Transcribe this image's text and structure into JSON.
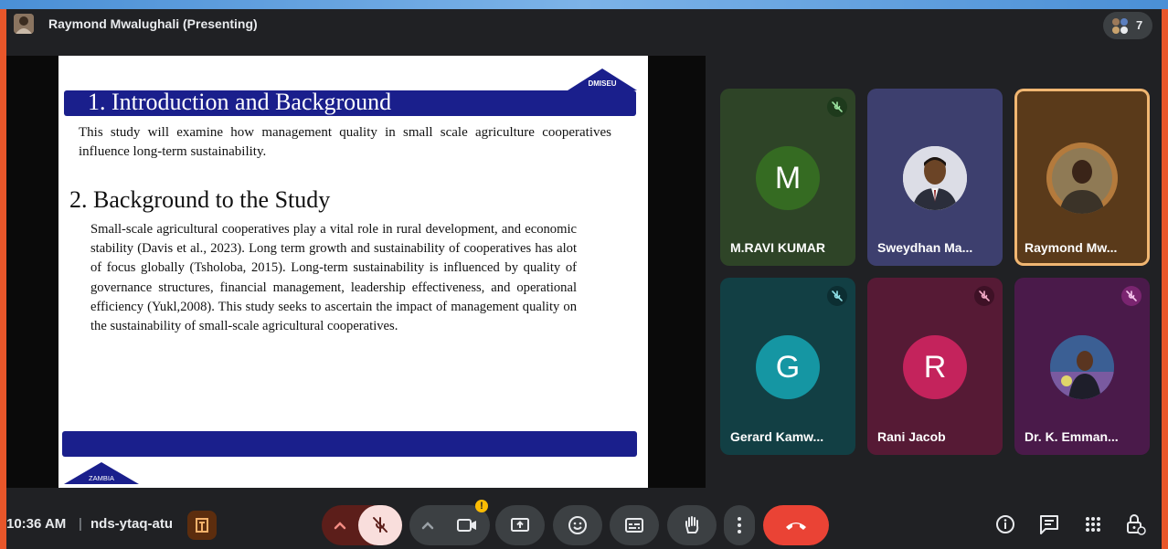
{
  "presenter": {
    "label": "Raymond Mwalughali (Presenting)",
    "participant_count": "7"
  },
  "slide": {
    "logo_text": "DMISEU",
    "heading1": "1. Introduction and Background",
    "intro": "This study will examine how management quality in small scale agriculture cooperatives influence long-term sustainability.",
    "heading2": "2. Background to the Study",
    "body": "Small-scale agricultural cooperatives play a vital role in rural development, and economic stability (Davis et al., 2023). Long term growth and sustainability of cooperatives has alot of focus globally (Tsholoba, 2015). Long-term sustainability is influenced by quality of governance structures, financial management, leadership effectiveness, and operational efficiency (Yukl,2008). This study seeks to ascertain the impact of management quality on the sustainability of small-scale agricultural cooperatives.",
    "footer_badge_text": "ZAMBIA"
  },
  "participants": [
    {
      "name": "M.RAVI KUMAR",
      "letter": "M",
      "muted": true,
      "bg": "#2f4a24",
      "avatar_bg": "#356b22",
      "avatar": "letter"
    },
    {
      "name": "Sweydhan Ma...",
      "letter": "",
      "muted": false,
      "bg": "#3d3f6e",
      "avatar": "photo"
    },
    {
      "name": "Raymond Mw...",
      "letter": "",
      "muted": false,
      "bg": "#5a3a1a",
      "avatar": "photo",
      "active_speaker": true
    },
    {
      "name": "Gerard Kamw...",
      "letter": "G",
      "muted": true,
      "bg": "#12484d",
      "avatar_bg": "#1596a3",
      "avatar": "letter"
    },
    {
      "name": "Rani Jacob",
      "letter": "R",
      "muted": true,
      "bg": "#5a1a36",
      "avatar_bg": "#c4235c",
      "avatar": "letter"
    },
    {
      "name": "Dr. K. Emman...",
      "letter": "",
      "muted": true,
      "bg": "#4a1a4a",
      "avatar": "photo"
    }
  ],
  "bottom_bar": {
    "time": "10:36 AM",
    "separator": "|",
    "meeting_code": "nds-ytaq-atu",
    "controls": [
      "mic-options-icon",
      "mic-off-icon",
      "camera-options-icon",
      "camera-icon",
      "present-screen-icon",
      "emoji-icon",
      "captions-icon",
      "raise-hand-icon",
      "more-options-icon",
      "leave-call-icon"
    ],
    "right_controls": [
      "info-icon",
      "chat-icon",
      "activities-icon",
      "host-controls-icon"
    ]
  },
  "colors": {
    "frame": "#e8562a",
    "background": "#202124",
    "leave": "#ea4335",
    "mic_off": "#f9dedc",
    "slide_bar": "#1a1f8c",
    "active_border": "#f0b672"
  }
}
